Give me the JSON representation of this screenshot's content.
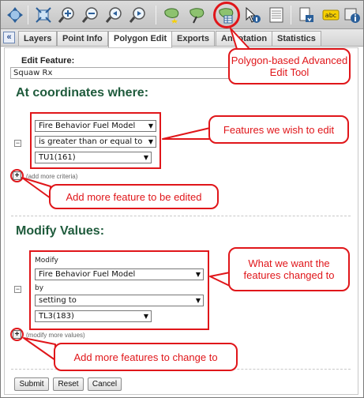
{
  "toolbar": {
    "icons": [
      "pan-icon",
      "full-extent-icon",
      "zoom-in-icon",
      "zoom-out-icon",
      "previous-extent-icon",
      "next-extent-icon",
      "add-polygon-icon",
      "edit-polygon-icon",
      "polygon-advanced-edit-icon",
      "identify-icon",
      "attribute-table-icon",
      "export-icon",
      "label-icon",
      "info-icon"
    ],
    "label_icon_text": "abc"
  },
  "tabs": {
    "collapse": "«",
    "items": [
      {
        "label": "Layers"
      },
      {
        "label": "Point Info"
      },
      {
        "label": "Polygon Edit"
      },
      {
        "label": "Exports"
      },
      {
        "label": "Annotation"
      },
      {
        "label": "Statistics"
      }
    ],
    "active": "Polygon Edit"
  },
  "edit_feature": {
    "label": "Edit Feature:",
    "value": "Squaw Rx"
  },
  "criteria": {
    "heading": "At coordinates where:",
    "field": "Fire Behavior Fuel Model",
    "operator": "is greater than or equal to",
    "value": "TU1(161)",
    "add_more": "(add more criteria)"
  },
  "modify": {
    "heading": "Modify Values:",
    "modify_label": "Modify",
    "field": "Fire Behavior Fuel Model",
    "by_label": "by",
    "operation": "setting to",
    "value": "TL3(183)",
    "add_more": "(modify more values)"
  },
  "buttons": {
    "submit": "Submit",
    "reset": "Reset",
    "cancel": "Cancel"
  },
  "callouts": {
    "tool": "Polygon-based Advanced Edit Tool",
    "features_edit": "Features we wish to edit",
    "add_feature": "Add more feature to be edited",
    "changed_to": "What we want the features changed to",
    "add_change": "Add more features to change to"
  },
  "colors": {
    "accent_red": "#e0161a",
    "heading_green": "#1f5b3c"
  }
}
